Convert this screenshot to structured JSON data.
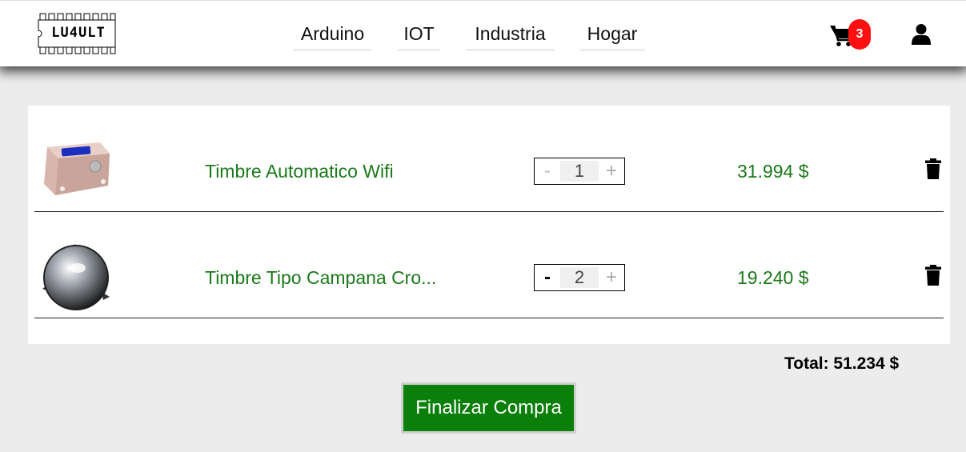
{
  "header": {
    "logo_text": "LU4ULT",
    "nav": [
      {
        "label": "Arduino"
      },
      {
        "label": "IOT"
      },
      {
        "label": "Industria"
      },
      {
        "label": "Hogar"
      }
    ],
    "cart_count": "3",
    "icons": {
      "cart": "shopping-cart-icon",
      "user": "user-icon"
    }
  },
  "cart": {
    "items": [
      {
        "name": "Timbre Automatico Wifi",
        "qty_minus": "-",
        "quantity": "1",
        "qty_plus": "+",
        "price": "31.994 $",
        "image": "wifi-doorbell-box-image"
      },
      {
        "name": "Timbre Tipo Campana Cro...",
        "qty_minus": "-",
        "quantity": "2",
        "qty_plus": "+",
        "price": "19.240 $",
        "image": "chrome-bell-image"
      }
    ],
    "total_label": "Total: 51.234 $",
    "checkout_label": "Finalizar Compra"
  },
  "colors": {
    "accent_green": "#0a7f0a",
    "price_green": "#1a7a1a",
    "badge_red": "#ff1010"
  }
}
